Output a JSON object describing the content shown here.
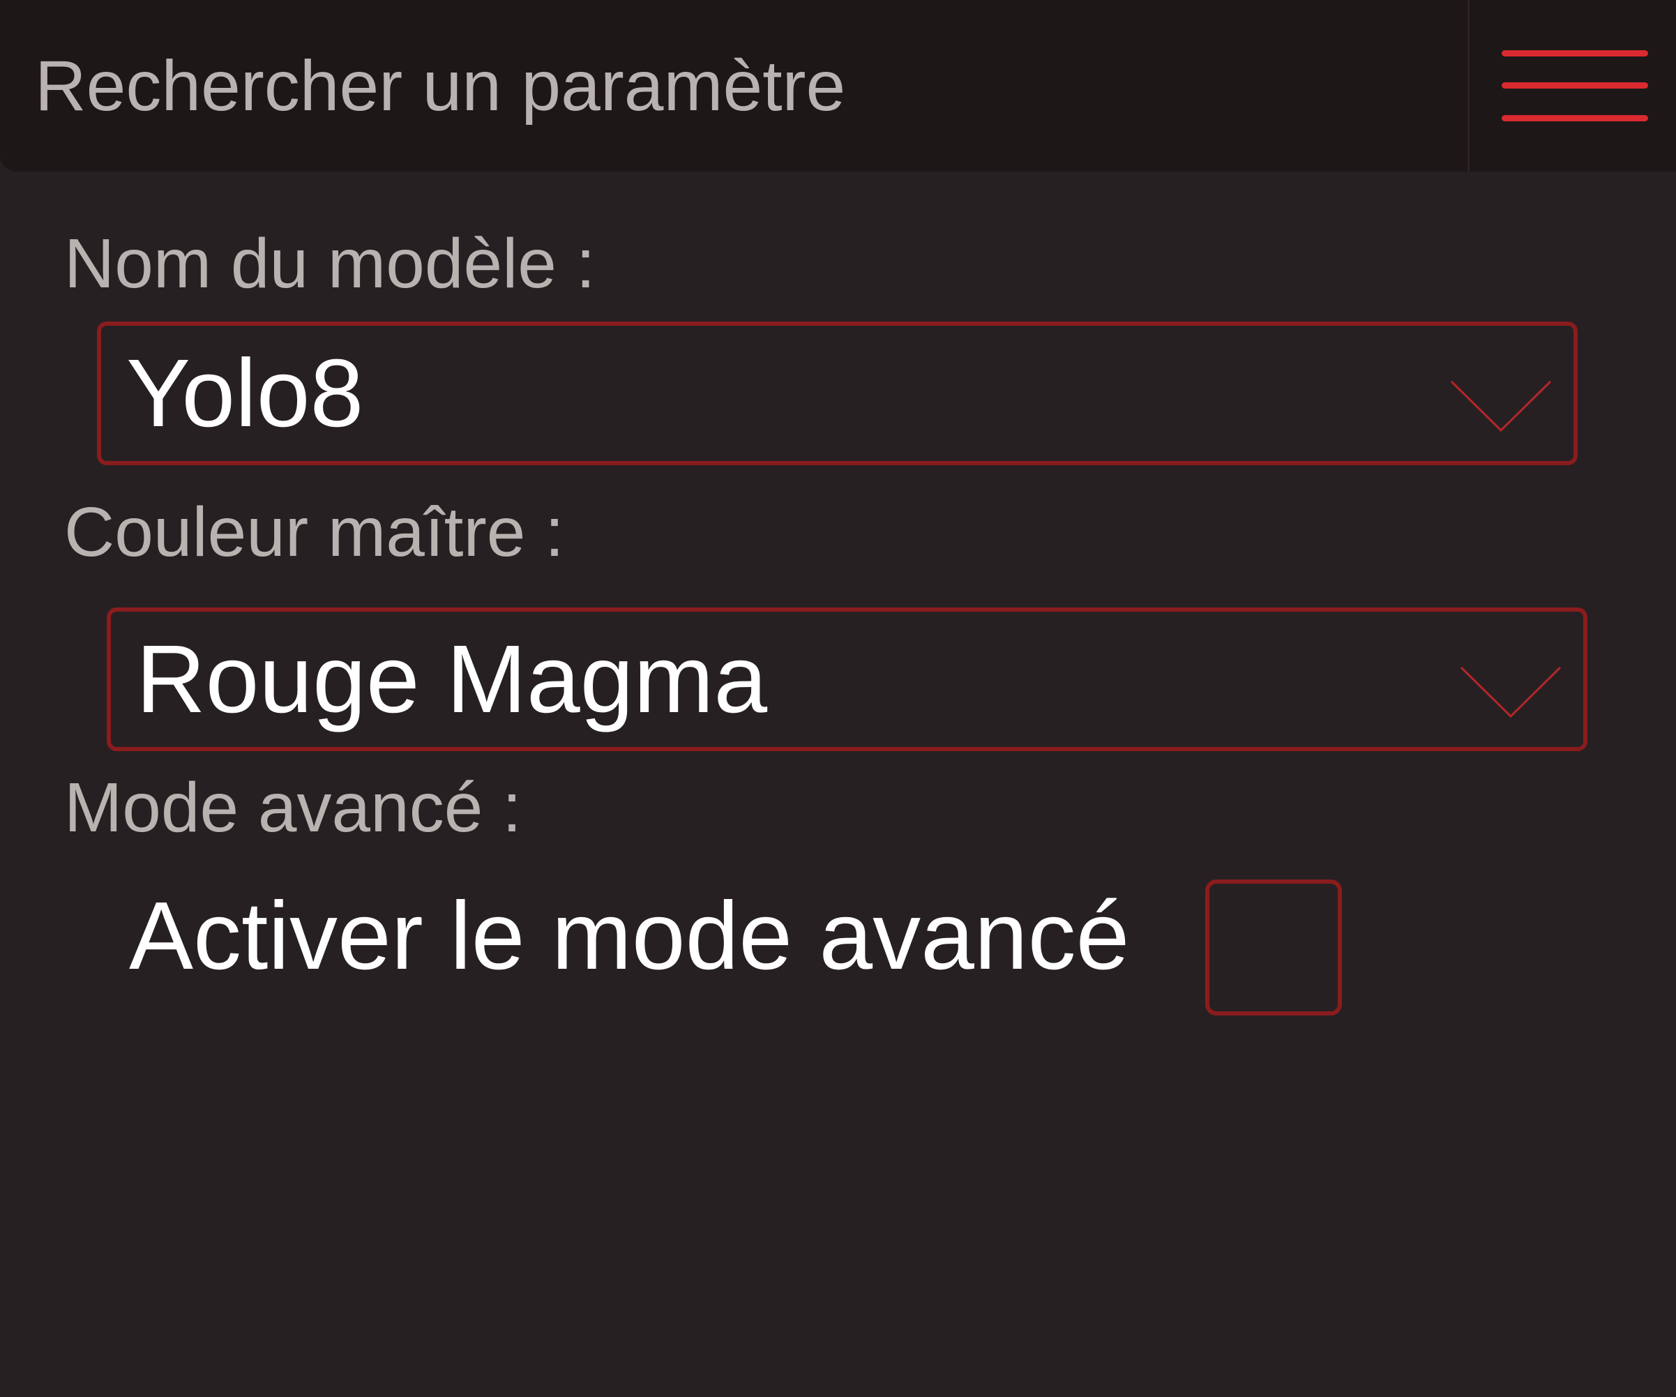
{
  "header": {
    "search_placeholder": "Rechercher un paramètre",
    "search_value": "",
    "menu_icon": "hamburger-menu-icon"
  },
  "fields": {
    "model": {
      "label": "Nom du modèle :",
      "selected": "Yolo8",
      "icon": "chevron-down-icon"
    },
    "master_color": {
      "label": "Couleur maître :",
      "selected": "Rouge Magma",
      "icon": "chevron-down-icon"
    },
    "advanced_mode": {
      "label": "Mode avancé :",
      "checkbox_label": "Activer le mode avancé",
      "checked": false
    }
  },
  "colors": {
    "background": "#262022",
    "header_background": "#1d1718",
    "accent": "#d92a30",
    "border": "#8a1c1e",
    "label_text": "#b8b2b0",
    "value_text": "#ffffff"
  }
}
